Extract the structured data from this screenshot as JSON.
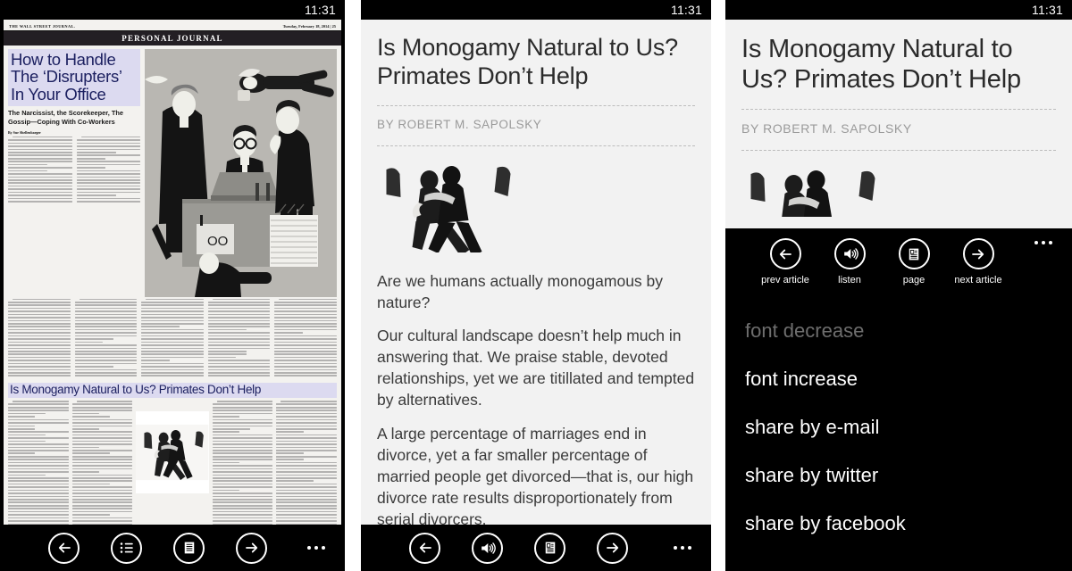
{
  "status": {
    "time": "11:31"
  },
  "left_phone": {
    "newspaper": {
      "masthead": "THE WALL STREET JOURNAL.",
      "date_line": "Tuesday, February 18, 2014 | 25",
      "section": "PERSONAL JOURNAL",
      "lead_article": {
        "headline": "How to Handle The ‘Disrupters’ In Your Office",
        "deck": "The Narcissist, the Scorekeeper, The Gossip—Coping With Co-Workers",
        "byline": "By Sue Shellenbarger"
      },
      "second_article": {
        "headline": "Is Monogamy Natural to Us? Primates Don’t Help",
        "byline": "By Robert M. Sapolsky"
      }
    },
    "appbar": {
      "buttons": [
        {
          "name": "prev-article",
          "icon": "back-arrow-icon"
        },
        {
          "name": "contents",
          "icon": "list-icon"
        },
        {
          "name": "page",
          "icon": "page-icon"
        },
        {
          "name": "next-article",
          "icon": "forward-arrow-icon"
        }
      ],
      "more": "more-icon"
    }
  },
  "middle_phone": {
    "article": {
      "title": "Is Monogamy Natural to Us? Primates Don’t Help",
      "byline": "BY ROBERT M. SAPOLSKY",
      "paragraphs": [
        "Are we humans actually monogamous by nature?",
        "Our cultural landscape doesn’t help much in answering that. We praise stable, devoted relationships, yet we are titillated and tempted by alternatives.",
        "A large percentage of marriages end in divorce, yet a far smaller percentage of married people get divorced—that is, our high divorce rate results disproportionately from serial divorcers."
      ]
    },
    "appbar": {
      "buttons": [
        {
          "name": "prev-article",
          "icon": "back-arrow-icon"
        },
        {
          "name": "listen",
          "icon": "speaker-icon"
        },
        {
          "name": "page",
          "icon": "page-icon"
        },
        {
          "name": "next-article",
          "icon": "forward-arrow-icon"
        }
      ],
      "more": "more-icon"
    }
  },
  "right_phone": {
    "article": {
      "title": "Is Monogamy Natural to Us? Primates Don’t Help",
      "byline": "BY ROBERT M. SAPOLSKY"
    },
    "menu": {
      "icons": [
        {
          "icon": "back-arrow-icon",
          "label": "prev article"
        },
        {
          "icon": "speaker-icon",
          "label": "listen"
        },
        {
          "icon": "page-icon",
          "label": "page"
        },
        {
          "icon": "forward-arrow-icon",
          "label": "next article"
        }
      ],
      "more": "more-icon",
      "items": [
        {
          "label": "font decrease",
          "disabled": true
        },
        {
          "label": "font increase",
          "disabled": false
        },
        {
          "label": "share by e-mail",
          "disabled": false
        },
        {
          "label": "share by twitter",
          "disabled": false
        },
        {
          "label": "share by facebook",
          "disabled": false
        }
      ]
    }
  },
  "colors": {
    "accent_headline": "#1c2060",
    "headline_highlight": "#dcdaf0",
    "reader_bg": "#f2f2f2",
    "appbar_bg": "#000000",
    "disabled_text": "#6e6e6e"
  }
}
